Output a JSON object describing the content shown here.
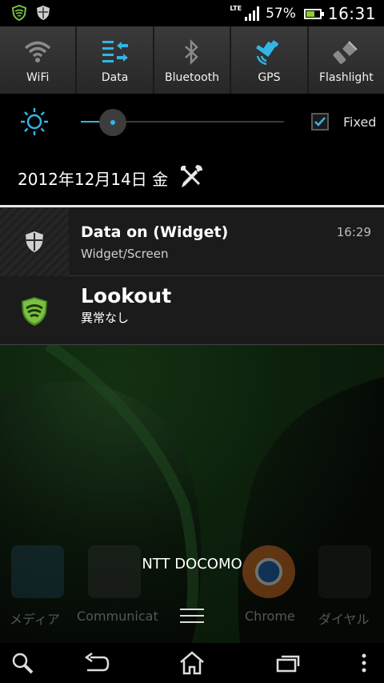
{
  "status_bar": {
    "network": "LTE",
    "battery_percent": "57%",
    "battery_level": 0.57,
    "time": "16:31",
    "icons": [
      "lookout-status-icon",
      "shield-status-icon"
    ]
  },
  "toggles": [
    {
      "label": "WiFi",
      "icon": "wifi-icon",
      "active": false
    },
    {
      "label": "Data",
      "icon": "data-icon",
      "active": true
    },
    {
      "label": "Bluetooth",
      "icon": "bluetooth-icon",
      "active": false
    },
    {
      "label": "GPS",
      "icon": "gps-icon",
      "active": true
    },
    {
      "label": "Flashlight",
      "icon": "flashlight-icon",
      "active": false
    }
  ],
  "brightness": {
    "level": 0.16,
    "fixed_label": "Fixed",
    "fixed_checked": true
  },
  "date": "2012年12月14日 金",
  "notifications": [
    {
      "title": "Data on (Widget)",
      "subtitle": "Widget/Screen",
      "time": "16:29",
      "icon": "shield-icon"
    },
    {
      "title": "Lookout",
      "subtitle": "異常なし",
      "icon": "lookout-icon"
    }
  ],
  "home": {
    "carrier": "NTT DOCOMO",
    "dock": [
      "メディア",
      "Communicat",
      "Chrome",
      "ダイヤル"
    ]
  },
  "nav": [
    "search-icon",
    "back-icon",
    "home-icon",
    "recents-icon",
    "menu-icon"
  ],
  "colors": {
    "accent": "#33b5e5",
    "lookout_green": "#7ac143",
    "toggle_bg": "#2c2c2c",
    "notification_bg": "#1b1b1b"
  }
}
